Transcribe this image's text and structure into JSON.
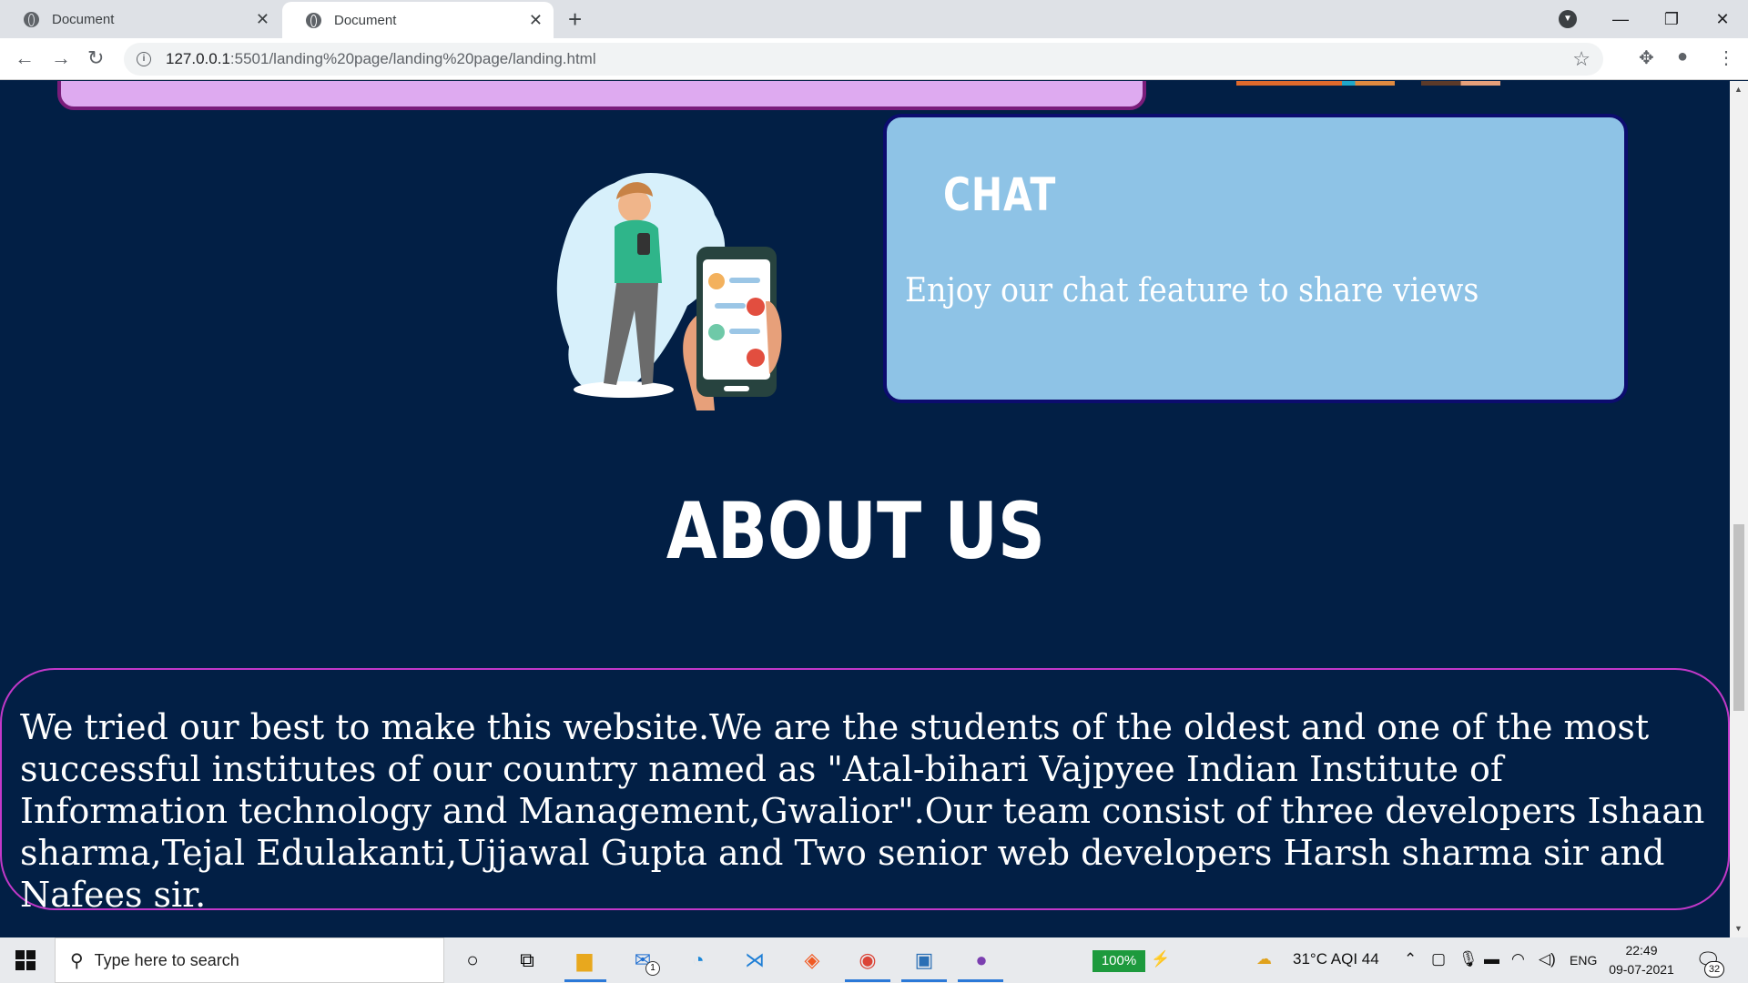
{
  "browser": {
    "tabs": [
      {
        "title": "Document",
        "active": false
      },
      {
        "title": "Document",
        "active": true
      }
    ],
    "url_host": "127.0.0.1",
    "url_path": ":5501/landing%20page/landing%20page/landing.html"
  },
  "page": {
    "chat_card": {
      "title": "CHAT",
      "text": "Enjoy our chat feature to share views"
    },
    "about": {
      "title": "ABOUT US",
      "text": "We tried our best to make this website.We are the students of the oldest and one of the most successful institutes of our country named as \"Atal-bihari Vajpyee Indian Institute of Information technology and Management,Gwalior\".Our team consist of three developers Ishaan sharma,Tejal Edulakanti,Ujjawal Gupta and Two senior web developers Harsh sharma sir and Nafees sir."
    },
    "colors": {
      "background": "#021f45",
      "chat_card": "#8ec3e6",
      "previous_card": "#deaaf0",
      "about_border": "#c238c9"
    }
  },
  "taskbar": {
    "search_placeholder": "Type here to search",
    "battery": "100%",
    "weather": "31°C  AQI 44",
    "language": "ENG",
    "time": "22:49",
    "date": "09-07-2021",
    "mail_badge": "1",
    "notification_count": "32",
    "apps": [
      "cortana-icon",
      "task-view-icon",
      "file-explorer-icon",
      "mail-icon",
      "edge-icon",
      "vscode-icon",
      "brave-icon",
      "chrome-icon",
      "photos-icon",
      "github-desktop-icon"
    ]
  }
}
